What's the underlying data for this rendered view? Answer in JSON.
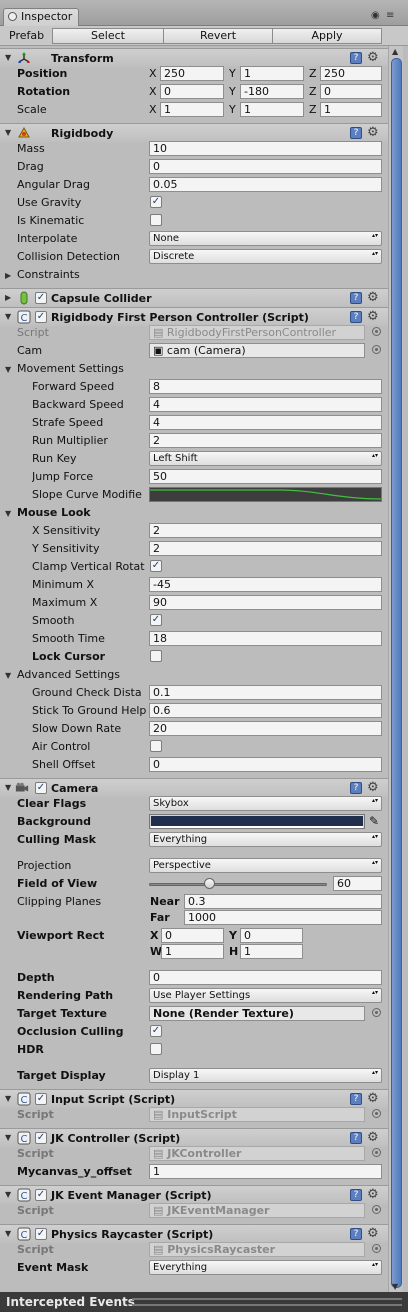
{
  "window": {
    "tab_label": "Inspector"
  },
  "prefab": {
    "label": "Prefab",
    "select": "Select",
    "revert": "Revert",
    "apply": "Apply"
  },
  "transform": {
    "title": "Transform",
    "position": {
      "label": "Position",
      "x": "250",
      "y": "1",
      "z": "250"
    },
    "rotation": {
      "label": "Rotation",
      "x": "0",
      "y": "-180",
      "z": "0"
    },
    "scale": {
      "label": "Scale",
      "x": "1",
      "y": "1",
      "z": "1"
    },
    "axis": {
      "x": "X",
      "y": "Y",
      "z": "Z"
    }
  },
  "rigidbody": {
    "title": "Rigidbody",
    "mass": {
      "label": "Mass",
      "value": "10"
    },
    "drag": {
      "label": "Drag",
      "value": "0"
    },
    "angular_drag": {
      "label": "Angular Drag",
      "value": "0.05"
    },
    "use_gravity": {
      "label": "Use Gravity",
      "checked": true
    },
    "is_kinematic": {
      "label": "Is Kinematic",
      "checked": false
    },
    "interpolate": {
      "label": "Interpolate",
      "value": "None"
    },
    "collision": {
      "label": "Collision Detection",
      "value": "Discrete"
    },
    "constraints": {
      "label": "Constraints"
    }
  },
  "capsule": {
    "title": "Capsule Collider"
  },
  "rbfpc": {
    "title": "Rigidbody First Person Controller (Script)",
    "script": {
      "label": "Script",
      "value": "RigidbodyFirstPersonController"
    },
    "cam": {
      "label": "Cam",
      "value": "cam (Camera)"
    },
    "movement": {
      "label": "Movement Settings",
      "forward": {
        "label": "Forward Speed",
        "value": "8"
      },
      "backward": {
        "label": "Backward Speed",
        "value": "4"
      },
      "strafe": {
        "label": "Strafe Speed",
        "value": "4"
      },
      "run_mult": {
        "label": "Run Multiplier",
        "value": "2"
      },
      "run_key": {
        "label": "Run Key",
        "value": "Left Shift"
      },
      "jump": {
        "label": "Jump Force",
        "value": "50"
      },
      "slope": {
        "label": "Slope Curve Modifie"
      }
    },
    "mouse_look": {
      "label": "Mouse Look",
      "x_sens": {
        "label": "X Sensitivity",
        "value": "2"
      },
      "y_sens": {
        "label": "Y Sensitivity",
        "value": "2"
      },
      "clamp": {
        "label": "Clamp Vertical Rotat",
        "checked": true
      },
      "min_x": {
        "label": "Minimum X",
        "value": "-45"
      },
      "max_x": {
        "label": "Maximum X",
        "value": "90"
      },
      "smooth": {
        "label": "Smooth",
        "checked": true
      },
      "smooth_time": {
        "label": "Smooth Time",
        "value": "18"
      },
      "lock_cursor": {
        "label": "Lock Cursor",
        "checked": false
      }
    },
    "advanced": {
      "label": "Advanced Settings",
      "ground_check": {
        "label": "Ground Check Dista",
        "value": "0.1"
      },
      "stick": {
        "label": "Stick To Ground Help",
        "value": "0.6"
      },
      "slow_down": {
        "label": "Slow Down Rate",
        "value": "20"
      },
      "air_control": {
        "label": "Air Control",
        "checked": false
      },
      "shell": {
        "label": "Shell Offset",
        "value": "0"
      }
    }
  },
  "camera": {
    "title": "Camera",
    "clear_flags": {
      "label": "Clear Flags",
      "value": "Skybox"
    },
    "background": {
      "label": "Background",
      "color": "#1f2f4d"
    },
    "culling": {
      "label": "Culling Mask",
      "value": "Everything"
    },
    "projection": {
      "label": "Projection",
      "value": "Perspective"
    },
    "fov": {
      "label": "Field of View",
      "value": "60",
      "fraction": 0.33
    },
    "clipping": {
      "label": "Clipping Planes",
      "near_label": "Near",
      "near": "0.3",
      "far_label": "Far",
      "far": "1000"
    },
    "viewport": {
      "label": "Viewport Rect",
      "x_label": "X",
      "x": "0",
      "y_label": "Y",
      "y": "0",
      "w_label": "W",
      "w": "1",
      "h_label": "H",
      "h": "1"
    },
    "depth": {
      "label": "Depth",
      "value": "0"
    },
    "rendering_path": {
      "label": "Rendering Path",
      "value": "Use Player Settings"
    },
    "target_texture": {
      "label": "Target Texture",
      "value": "None (Render Texture)"
    },
    "occlusion": {
      "label": "Occlusion Culling",
      "checked": true
    },
    "hdr": {
      "label": "HDR",
      "checked": false
    },
    "target_display": {
      "label": "Target Display",
      "value": "Display 1"
    }
  },
  "input_script": {
    "title": "Input Script (Script)",
    "script_label": "Script",
    "script": "InputScript"
  },
  "jk_controller": {
    "title": "JK Controller (Script)",
    "script_label": "Script",
    "script": "JKController",
    "offset": {
      "label": "Mycanvas_y_offset",
      "value": "1"
    }
  },
  "jk_event": {
    "title": "JK Event Manager (Script)",
    "script_label": "Script",
    "script": "JKEventManager"
  },
  "physics_raycaster": {
    "title": "Physics Raycaster (Script)",
    "script_label": "Script",
    "script": "PhysicsRaycaster",
    "event_mask": {
      "label": "Event Mask",
      "value": "Everything"
    }
  },
  "footer": {
    "label": "Intercepted Events"
  }
}
